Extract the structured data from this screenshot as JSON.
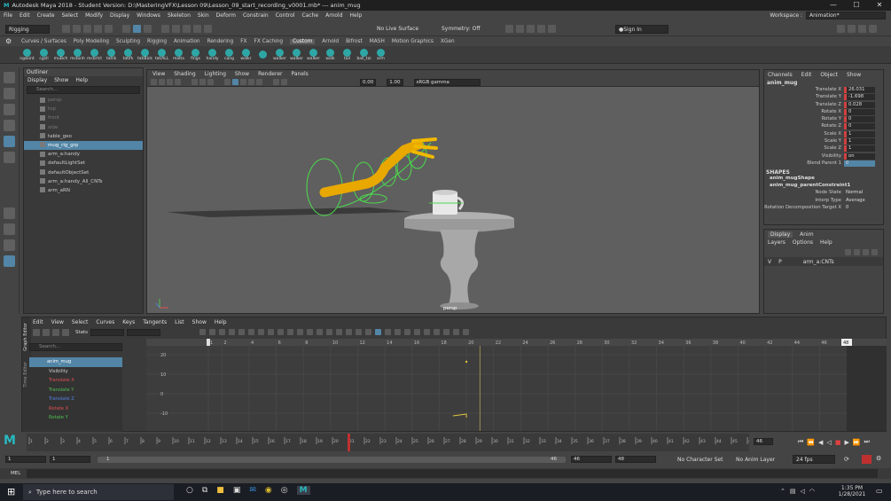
{
  "window": {
    "title": "Autodesk Maya 2018 - Student Version: D:\\MasteringVFX\\Lesson 09\\Lesson_09_start_recording_v0001.mb* --- anim_mug",
    "minimize": "—",
    "maximize": "☐",
    "close": "✕"
  },
  "menubar": [
    "File",
    "Edit",
    "Create",
    "Select",
    "Modify",
    "Display",
    "Windows",
    "Skeleton",
    "Skin",
    "Deform",
    "Constrain",
    "Control",
    "Cache",
    "Arnold",
    "Help"
  ],
  "workspace": {
    "label": "Workspace :",
    "value": "Animation*"
  },
  "statusline": {
    "mode": "Rigging",
    "live_surface": "No Live Surface",
    "symmetry": "Symmetry: Off",
    "signin": "Sign In"
  },
  "shelf_tabs": [
    "Curves / Surfaces",
    "Poly Modeling",
    "Sculpting",
    "Rigging",
    "Animation",
    "Rendering",
    "FX",
    "FX Caching",
    "Custom",
    "Arnold",
    "Bifrost",
    "MASH",
    "Motion Graphics",
    "XGen"
  ],
  "shelf_tab_active": "Custom",
  "shelf_buttons": [
    "ngskint",
    "cgsll",
    "muBch",
    "mcbinh",
    "mcbrlct",
    "tatilk",
    "tatifk",
    "tatiBlck",
    "tatiALL",
    "malta",
    "flngs",
    "handy",
    "cang",
    "walkr",
    "",
    "walker",
    "walker",
    "walker",
    "walk",
    "tail",
    "ball_tai",
    "arm"
  ],
  "outliner": {
    "title": "Outliner",
    "menu": [
      "Display",
      "Show",
      "Help"
    ],
    "search": "Search...",
    "items": [
      {
        "label": "persp",
        "dim": true,
        "indent": 0
      },
      {
        "label": "top",
        "dim": true,
        "indent": 0
      },
      {
        "label": "front",
        "dim": true,
        "indent": 0
      },
      {
        "label": "side",
        "dim": true,
        "indent": 0
      },
      {
        "label": "table_geo",
        "dim": false,
        "indent": 0
      },
      {
        "label": "mug_rig_grp",
        "dim": false,
        "indent": 0,
        "highlight": true
      },
      {
        "label": "arm_a:handy",
        "dim": false,
        "indent": 0
      },
      {
        "label": "defaultLightSet",
        "dim": false,
        "indent": 0
      },
      {
        "label": "defaultObjectSet",
        "dim": false,
        "indent": 0
      },
      {
        "label": "arm_a:handy_All_CNTs",
        "dim": false,
        "indent": 0
      },
      {
        "label": "arm_aRN",
        "dim": false,
        "indent": 0
      }
    ]
  },
  "viewport": {
    "menu": [
      "View",
      "Shading",
      "Lighting",
      "Show",
      "Renderer",
      "Panels"
    ],
    "exposure": "0.00",
    "gamma": "1.00",
    "colorspace": "sRGB gamma",
    "camera_label": "persp"
  },
  "channelbox": {
    "tabs": [
      "Channels",
      "Edit",
      "Object",
      "Show"
    ],
    "object": "anim_mug",
    "channels": [
      {
        "name": "Translate X",
        "value": "26.031",
        "keyed": true
      },
      {
        "name": "Translate Y",
        "value": "-1.698",
        "keyed": true
      },
      {
        "name": "Translate Z",
        "value": "0.028",
        "keyed": true
      },
      {
        "name": "Rotate X",
        "value": "0",
        "keyed": true
      },
      {
        "name": "Rotate Y",
        "value": "0",
        "keyed": true
      },
      {
        "name": "Rotate Z",
        "value": "0",
        "keyed": true
      },
      {
        "name": "Scale X",
        "value": "1",
        "keyed": true
      },
      {
        "name": "Scale Y",
        "value": "1",
        "keyed": true
      },
      {
        "name": "Scale Z",
        "value": "1",
        "keyed": true
      },
      {
        "name": "Visibility",
        "value": "on",
        "keyed": true
      },
      {
        "name": "Blend Parent 1",
        "value": "0",
        "keyed": false,
        "blue": true
      }
    ],
    "shapes_header": "SHAPES",
    "shape1": "anim_mugShape",
    "shape2": "anim_mug_parentConstraint1",
    "attrs": [
      {
        "name": "Node State",
        "value": "Normal"
      },
      {
        "name": "Interp Type",
        "value": "Average"
      },
      {
        "name": "Rotation Decomposition Target X",
        "value": "0"
      }
    ]
  },
  "layers": {
    "tabs": [
      "Display",
      "Anim"
    ],
    "menu": [
      "Layers",
      "Options",
      "Help"
    ],
    "layer": {
      "v": "V",
      "p": "P",
      "name": "arm_a:CNTs"
    }
  },
  "graph_editor": {
    "side_title": "Graph Editor",
    "side_title2": "Time Editor",
    "menu": [
      "Edit",
      "View",
      "Select",
      "Curves",
      "Keys",
      "Tangents",
      "List",
      "Show",
      "Help"
    ],
    "stats": "Stats",
    "search": "Search...",
    "curves": [
      {
        "label": "anim_mug",
        "color": "#ffffff",
        "header": true
      },
      {
        "label": "Visibility",
        "color": "#cccccc"
      },
      {
        "label": "Translate X",
        "color": "#e05050"
      },
      {
        "label": "Translate Y",
        "color": "#50c050"
      },
      {
        "label": "Translate Z",
        "color": "#5080e0"
      },
      {
        "label": "Rotate X",
        "color": "#e05050"
      },
      {
        "label": "Rotate Y",
        "color": "#50c050"
      }
    ],
    "top_ticks": [
      "1",
      "2",
      "4",
      "6",
      "8",
      "10",
      "12",
      "14",
      "16",
      "18",
      "20",
      "22",
      "24",
      "26",
      "28",
      "30",
      "32",
      "34",
      "36",
      "38",
      "40",
      "42",
      "44",
      "46"
    ],
    "y_ticks": [
      "20",
      "10",
      "0",
      "-10"
    ],
    "end_frame": "48"
  },
  "timeline": {
    "ticks": [
      "1",
      "2",
      "3",
      "4",
      "5",
      "6",
      "7",
      "8",
      "9",
      "10",
      "11",
      "12",
      "13",
      "14",
      "15",
      "16",
      "17",
      "18",
      "19",
      "20",
      "21",
      "22",
      "23",
      "24",
      "25",
      "26",
      "27",
      "28",
      "29",
      "30",
      "31",
      "32",
      "33",
      "34",
      "35",
      "36",
      "37",
      "38",
      "39",
      "40",
      "41",
      "42",
      "43",
      "44",
      "45",
      "46"
    ],
    "current": "21",
    "end": "46",
    "start_box": "1",
    "start_box2": "1",
    "range_start": "1",
    "range_end": "46",
    "end1": "46",
    "end2": "48",
    "char_set": "No Character Set",
    "anim_layer": "No Anim Layer",
    "fps": "24 fps"
  },
  "cmdline": {
    "label": "MEL"
  },
  "taskbar": {
    "search": "Type here to search",
    "time": "1:35 PM",
    "date": "1/28/2021"
  }
}
